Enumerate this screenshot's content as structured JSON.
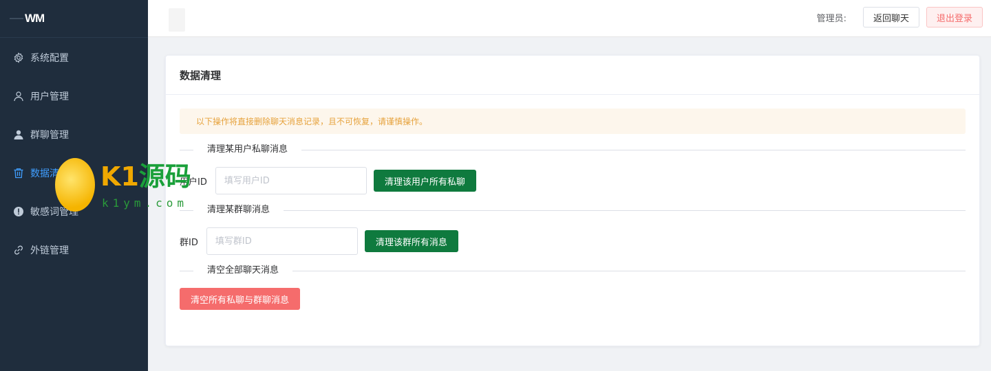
{
  "logo": {
    "text": "WM"
  },
  "sidebar": {
    "items": [
      {
        "label": "系统配置",
        "icon": "gear-icon"
      },
      {
        "label": "用户管理",
        "icon": "user-outline-icon"
      },
      {
        "label": "群聊管理",
        "icon": "user-filled-icon"
      },
      {
        "label": "数据清理",
        "icon": "trash-icon",
        "active": true
      },
      {
        "label": "敏感词管理",
        "icon": "warning-icon"
      },
      {
        "label": "外链管理",
        "icon": "link-icon"
      }
    ]
  },
  "header": {
    "admin_label": "管理员:",
    "back_button": "返回聊天",
    "logout_button": "退出登录"
  },
  "card": {
    "title": "数据清理",
    "alert": "以下操作将直接删除聊天消息记录，且不可恢复，请谨慎操作。",
    "private_section": {
      "title": "清理某用户私聊消息",
      "label": "用户ID",
      "placeholder": "填写用户ID",
      "button": "清理该用户所有私聊"
    },
    "group_section": {
      "title": "清理某群聊消息",
      "label": "群ID",
      "placeholder": "填写群ID",
      "button": "清理该群所有消息"
    },
    "all_section": {
      "title": "清空全部聊天消息",
      "button": "清空所有私聊与群聊消息"
    }
  },
  "watermark": {
    "brand": "K1",
    "brand_cn": "源码",
    "url": "k1ym.com"
  },
  "colors": {
    "sidebar_bg": "#1f2d3d",
    "active": "#409eff",
    "success": "#0f7a3e",
    "danger": "#f56c6c",
    "warning": "#e6a23c"
  }
}
